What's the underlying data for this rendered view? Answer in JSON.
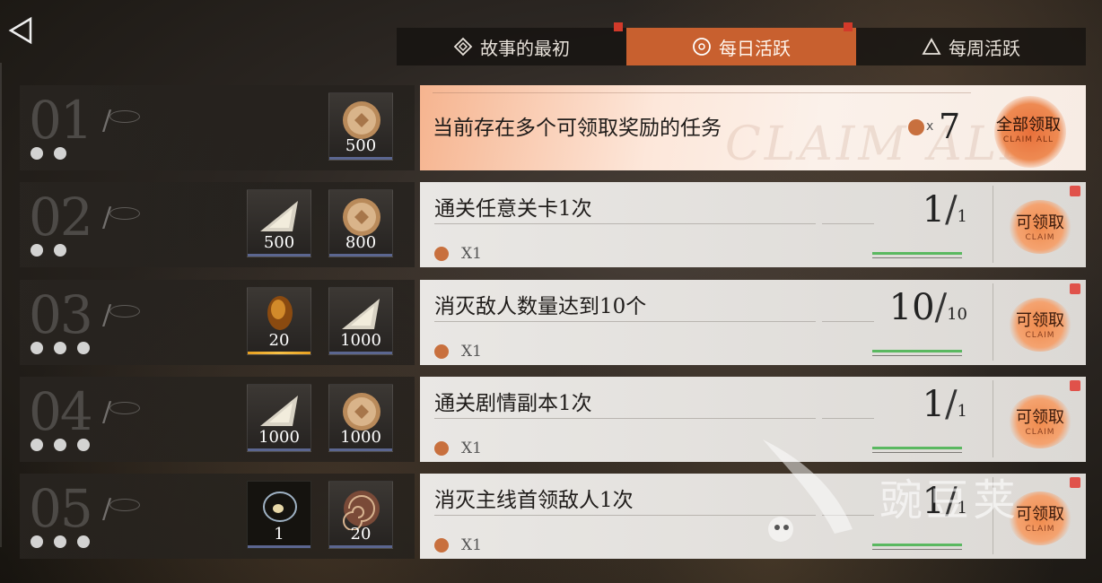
{
  "tabs": [
    {
      "label": "故事的最初",
      "icon": "diamond-icon",
      "active": false,
      "badge": true
    },
    {
      "label": "每日活跃",
      "icon": "circle-target-icon",
      "active": true,
      "badge": true
    },
    {
      "label": "每周活跃",
      "icon": "triangle-icon",
      "active": false,
      "badge": false
    }
  ],
  "claim_all": {
    "message": "当前存在多个可领取奖励的任务",
    "ghost_text": "CLAIM ALL",
    "count_x": "x",
    "count": "7",
    "button_label": "全部领取",
    "button_sub": "CLAIM ALL"
  },
  "rows": [
    {
      "num": "01",
      "dots": 2,
      "rewards": [
        {
          "icon": "coin-icon",
          "amount": "500"
        }
      ]
    },
    {
      "num": "02",
      "dots": 2,
      "rewards": [
        {
          "icon": "crystal-shard-icon",
          "amount": "500"
        },
        {
          "icon": "coin-icon",
          "amount": "800"
        }
      ],
      "task": "通关任意关卡1次",
      "token": "X1",
      "current": "1",
      "total": "1",
      "claim": "可领取",
      "claim_sub": "CLAIM"
    },
    {
      "num": "03",
      "dots": 3,
      "rewards": [
        {
          "icon": "amber-gem-icon",
          "amount": "20"
        },
        {
          "icon": "crystal-shard-icon",
          "amount": "1000"
        }
      ],
      "task": "消灭敌人数量达到10个",
      "token": "X1",
      "current": "10",
      "total": "10",
      "claim": "可领取",
      "claim_sub": "CLAIM"
    },
    {
      "num": "04",
      "dots": 3,
      "rewards": [
        {
          "icon": "crystal-shard-icon",
          "amount": "1000"
        },
        {
          "icon": "coin-icon",
          "amount": "1000"
        }
      ],
      "task": "通关剧情副本1次",
      "token": "X1",
      "current": "1",
      "total": "1",
      "claim": "可领取",
      "claim_sub": "CLAIM"
    },
    {
      "num": "05",
      "dots": 3,
      "rewards": [
        {
          "icon": "glass-orb-icon",
          "amount": "1"
        },
        {
          "icon": "ammonite-icon",
          "amount": "20"
        }
      ],
      "task": "消灭主线首领敌人1次",
      "token": "X1",
      "current": "1",
      "total": "1",
      "claim": "可领取",
      "claim_sub": "CLAIM"
    }
  ],
  "watermark": "豌豆荚",
  "colors": {
    "accent": "#c8602f",
    "badge": "#e0524a",
    "progress": "#5ab860"
  }
}
